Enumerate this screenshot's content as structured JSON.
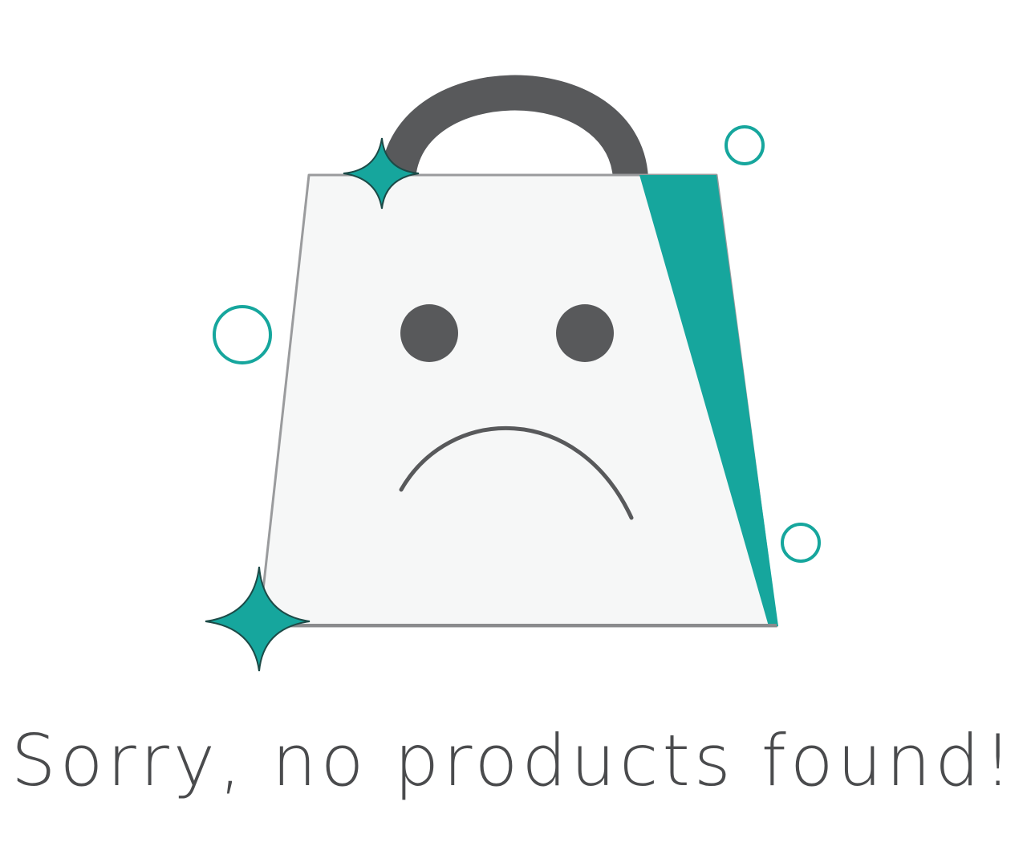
{
  "empty_state": {
    "message": "Sorry, no products found!",
    "icon": "sad-shopping-bag-icon"
  },
  "colors": {
    "accent_teal": "#16a69d",
    "dark_gray": "#58595b",
    "bag_fill": "#f6f7f7",
    "bag_edge": "#9a9b9d",
    "text": "#4a4b4d",
    "background": "#ffffff"
  }
}
